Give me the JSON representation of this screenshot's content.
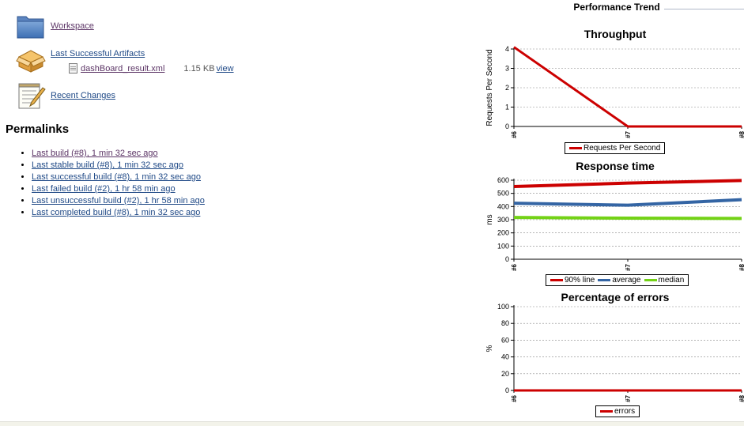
{
  "tasks": {
    "workspace": "Workspace",
    "artifacts": "Last Successful Artifacts",
    "recent_changes": "Recent Changes"
  },
  "artifact": {
    "file": "dashBoard_result.xml",
    "size": "1.15 KB",
    "view": "view"
  },
  "permalinks": {
    "heading": "Permalinks",
    "items": [
      "Last build (#8), 1 min 32 sec ago",
      "Last stable build (#8), 1 min 32 sec ago",
      "Last successful build (#8), 1 min 32 sec ago",
      "Last failed build (#2), 1 hr 58 min ago",
      "Last unsuccessful build (#2), 1 hr 58 min ago",
      "Last completed build (#8), 1 min 32 sec ago"
    ]
  },
  "performance_trend": {
    "title": "Performance Trend"
  },
  "chart_data": [
    {
      "type": "line",
      "title": "Throughput",
      "categories": [
        "#6",
        "#7",
        "#8"
      ],
      "ylabel": "Requests Per Second",
      "ylim": [
        0,
        4
      ],
      "yticks": [
        "0",
        "1",
        "2",
        "3",
        "4"
      ],
      "series": [
        {
          "name": "Requests Per Second",
          "color": "#cc0000",
          "values": [
            4.1,
            0,
            0
          ]
        }
      ],
      "legend": "bottom"
    },
    {
      "type": "line",
      "title": "Response time",
      "categories": [
        "#6",
        "#7",
        "#8"
      ],
      "ylabel": "ms",
      "ylim": [
        0,
        600
      ],
      "yticks": [
        "0",
        "100",
        "200",
        "300",
        "400",
        "500",
        "600"
      ],
      "series": [
        {
          "name": "90% line",
          "color": "#cc0000",
          "values": [
            552,
            578,
            598
          ]
        },
        {
          "name": "average",
          "color": "#3465a4",
          "values": [
            425,
            410,
            452
          ]
        },
        {
          "name": "median",
          "color": "#73d216",
          "values": [
            317,
            312,
            310
          ]
        }
      ],
      "legend": "bottom"
    },
    {
      "type": "line",
      "title": "Percentage of errors",
      "categories": [
        "#6",
        "#7",
        "#8"
      ],
      "ylabel": "%",
      "ylim": [
        0,
        100
      ],
      "yticks": [
        "0",
        "20",
        "40",
        "60",
        "80",
        "100"
      ],
      "series": [
        {
          "name": "errors",
          "color": "#cc0000",
          "values": [
            0,
            0,
            0
          ]
        }
      ],
      "legend": "bottom"
    }
  ]
}
